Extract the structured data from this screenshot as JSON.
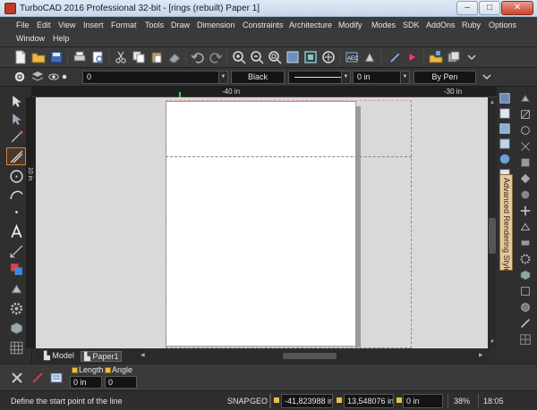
{
  "window": {
    "title": "TurboCAD 2016 Professional 32-bit - [rings (rebuilt) Paper 1]",
    "controls": [
      "–",
      "□",
      "✕"
    ]
  },
  "menu": {
    "row1": [
      "File",
      "Edit",
      "View",
      "Insert",
      "Format",
      "Tools",
      "Draw",
      "Dimension",
      "Constraints",
      "Architecture",
      "Modify",
      "Modes",
      "SDK",
      "AddOns",
      "Ruby",
      "Options"
    ],
    "row2": [
      "Window",
      "Help"
    ]
  },
  "toolbar1": {
    "icons": [
      "new-file",
      "open-folder",
      "save",
      "print",
      "print-preview",
      "cut",
      "copy",
      "paste",
      "eraser",
      "undo",
      "redo",
      "zoom-in",
      "zoom-out",
      "zoom-window",
      "zoom-extents",
      "pan",
      "render",
      "material",
      "color-fill",
      "layers",
      "snap",
      "measure"
    ]
  },
  "properties_bar": {
    "layer_value": "0",
    "color_value": "Black",
    "linewidth_value": "0 in",
    "pen_value": "By Pen"
  },
  "ruler": {
    "top_labels": [
      "-40 in",
      "-30 in"
    ],
    "left_label": "10 in"
  },
  "sheet_tabs": {
    "model": "Model",
    "paper": "Paper1"
  },
  "sidebar": {
    "label": "Advanced Rendering Styles"
  },
  "inspector": {
    "length_label": "Length",
    "length_value": "0 in",
    "angle_label": "Angle",
    "angle_value": "0"
  },
  "status": {
    "prompt": "Define the start point of the line",
    "snap": "SNAP",
    "geo": "GEO",
    "x_coord": "-41,823988 in",
    "y_coord": "13,548076 in",
    "z_coord": "0 in",
    "zoom": "38%",
    "time": "18:05"
  },
  "colors": {
    "accent": "#d0813a",
    "canvas": "#d9d9d9",
    "paper": "#ffffff",
    "background": "#2d2d2d"
  }
}
